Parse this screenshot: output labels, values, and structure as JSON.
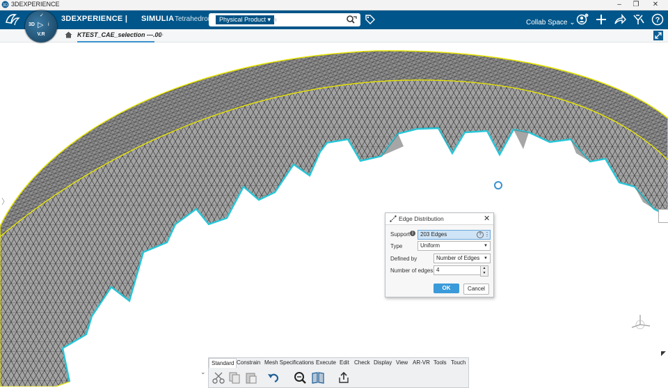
{
  "window": {
    "title": "3DEXPERIENCE",
    "controls": [
      "minimize-icon",
      "restore-icon",
      "close-icon"
    ]
  },
  "header": {
    "brand": "3DEXPERIENCE |",
    "brand_product": "SIMULIA",
    "app_name": "Tetrahedron Mesher",
    "compass": {
      "left": "3D",
      "center": "play-icon",
      "right": "i",
      "bottom": "V.R"
    },
    "search": {
      "scope": "Physical Product",
      "placeholder": "n"
    },
    "collab_space": "Collab Space",
    "colors": {
      "bar": "#00568a",
      "scope": "#005386"
    }
  },
  "tabs": {
    "active": "KTEST_CAE_selection ---.00",
    "add": "+"
  },
  "viewport": {
    "mesh_color": "#9c9c9c",
    "selected_edge_color": "#25c7d8",
    "boundary_color": "#e8e400"
  },
  "dialog": {
    "title": "Edge Distribution",
    "support_label": "Support",
    "support_value": "203 Edges",
    "type_label": "Type",
    "type_value": "Uniform",
    "defined_by_label": "Defined by",
    "defined_by_value": "Number of Edges",
    "number_label": "Number of edges",
    "number_value": "4",
    "ok": "OK",
    "cancel": "Cancel"
  },
  "action_bar": {
    "tabs": [
      "Standard",
      "Constrain",
      "Mesh Specifications",
      "Execute",
      "Edit",
      "Check",
      "Display",
      "View",
      "AR-VR",
      "Tools",
      "Touch"
    ],
    "active_tab": "Standard",
    "buttons": [
      "cut-icon",
      "copy-icon",
      "paste-icon",
      "undo-icon",
      "search-zoom-icon",
      "book-icon",
      "share-icon"
    ]
  }
}
